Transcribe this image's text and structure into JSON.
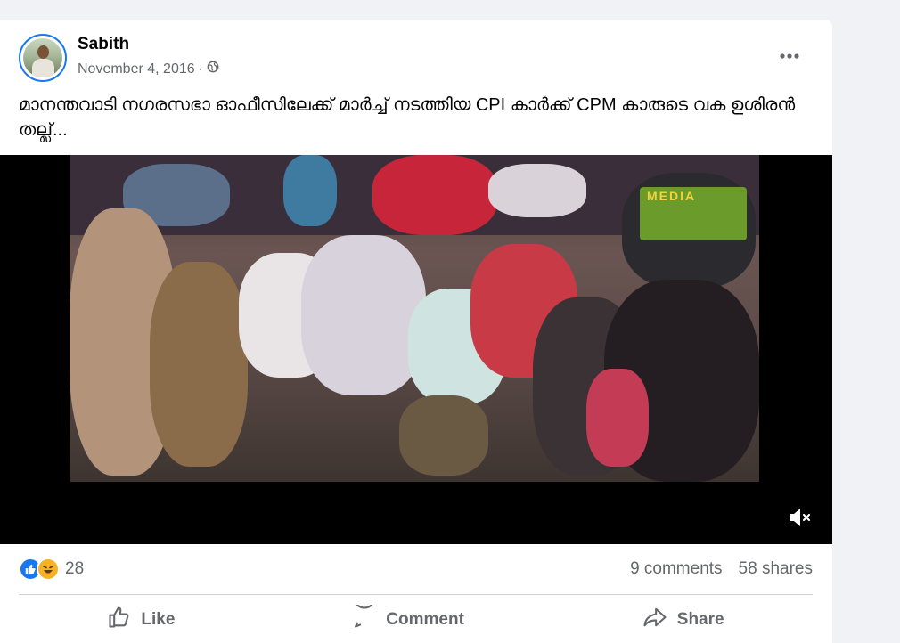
{
  "post": {
    "author": "Sabith",
    "date": "November 4, 2016",
    "separator": "·",
    "privacy_icon": "globe-icon",
    "more_icon": "more-options-icon",
    "text": "മാനന്തവാടി നഗരസഭാ ഓഫീസിലേക്ക് മാർച്ച് നടത്തിയ CPI കാർക്ക് CPM കാരുടെ വക ഉശിരൻ തല്ല്..."
  },
  "video": {
    "overlay_text": "MEDIA",
    "mute_icon": "volume-muted-icon"
  },
  "stats": {
    "reaction_count": "28",
    "comments": "9 comments",
    "shares": "58 shares"
  },
  "actions": {
    "like": "Like",
    "comment": "Comment",
    "share": "Share"
  },
  "colors": {
    "accent": "#1877f2",
    "muted_text": "#65676b",
    "text": "#050505",
    "haha": "#f7b125"
  }
}
